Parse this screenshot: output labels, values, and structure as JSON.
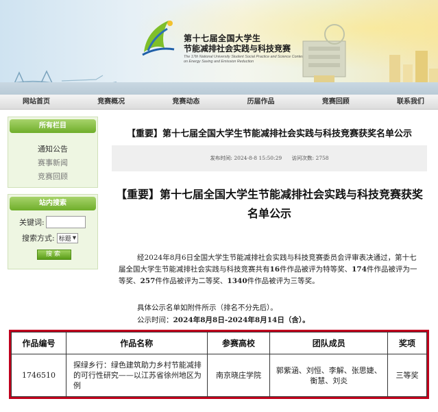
{
  "banner": {
    "title_line1": "第十七届全国大学生",
    "title_line2": "节能减排社会实践与科技竞赛",
    "title_en": "The 17th National University Student Social Practice and Science Contest on Energy Saving and Emission Reduction",
    "logo_icon": "contest-logo-icon"
  },
  "nav": {
    "items": [
      "网站首页",
      "竞赛概况",
      "竞赛动态",
      "历届作品",
      "竞赛回顾",
      "联系我们"
    ]
  },
  "sidebar": {
    "columns_title": "所有栏目",
    "columns": [
      "通知公告",
      "赛事新闻",
      "竞赛回顾"
    ],
    "search_title": "站内搜索",
    "keyword_label": "关键词:",
    "keyword_value": "",
    "method_label": "搜索方式:",
    "method_value": "标题",
    "search_button": "搜索"
  },
  "article": {
    "header": "【重要】第十七届全国大学生节能减排社会实践与科技竞赛获奖名单公示",
    "publish_label": "发布时间:",
    "publish_time": "2024-8-8 15:50:29",
    "visits_label": "访问次数:",
    "visits": "2758",
    "title": "【重要】第十七届全国大学生节能减排社会实践与科技竞赛获奖名单公示",
    "para_1": "经2024年8月6日全国大学生节能减排社会实践与科技竞赛委员会评审表决通过，第十七届全国大学生节能减排社会实践与科技竞赛共有",
    "num_special": "16",
    "para_2": "件作品被评为特等奖、",
    "num_first": "174",
    "para_3": "件作品被评为一等奖、",
    "num_second": "257",
    "para_4": "件作品被评为二等奖、",
    "num_third": "1340",
    "para_5": "件作品被评为三等奖。",
    "list_note": "具体公示名单如附件所示（排名不分先后）。",
    "period_label": "公示时间：",
    "period": "2024年8月8日-2024年8月14日（含）。"
  },
  "table": {
    "headers": [
      "作品编号",
      "作品名称",
      "参赛高校",
      "团队成员",
      "奖项"
    ],
    "rows": [
      {
        "id": "1746510",
        "name": "探绿乡行：绿色建筑助力乡村节能减排的可行性研究——以江苏省徐州地区为例",
        "school": "南京晓庄学院",
        "members": "郭紫涵、刘恒、李解、张思婕、衡慧、刘炎",
        "award": "三等奖"
      }
    ]
  },
  "colors": {
    "highlight_border": "#c0001d",
    "sidebar_head": "#6fae2a"
  }
}
